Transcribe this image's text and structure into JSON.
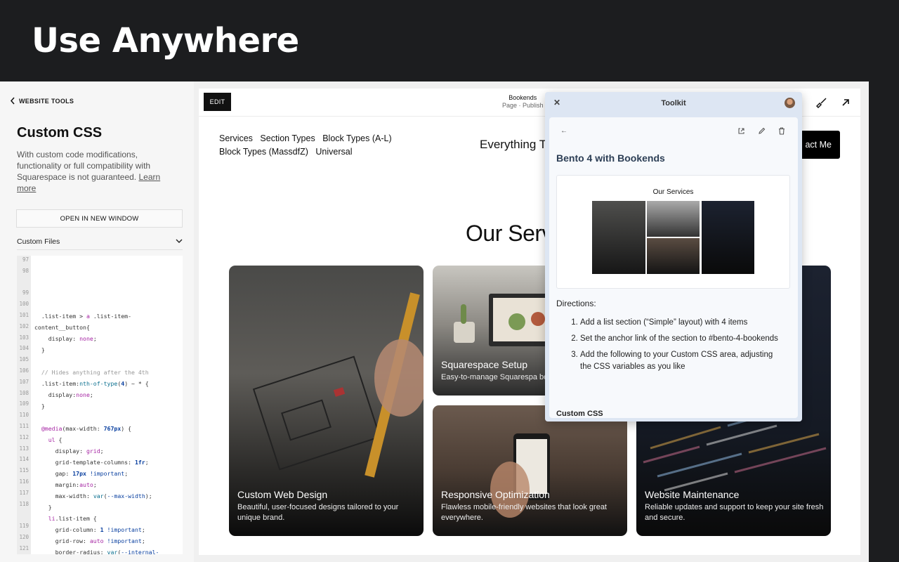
{
  "hero": {
    "title": "Use Anywhere"
  },
  "panel": {
    "back_label": "WEBSITE TOOLS",
    "title": "Custom CSS",
    "description": "With custom code modifications, functionality or full compatibility with Squarespace is not guaranteed.",
    "learn_more": "Learn more",
    "open_button": "OPEN IN NEW WINDOW",
    "files_label": "Custom Files"
  },
  "code": {
    "line_numbers": [
      "97",
      "98",
      "",
      "99",
      "100",
      "101",
      "102",
      "103",
      "104",
      "105",
      "106",
      "107",
      "108",
      "109",
      "110",
      "111",
      "112",
      "113",
      "114",
      "115",
      "116",
      "117",
      "118",
      "",
      "119",
      "120",
      "121"
    ]
  },
  "topbar": {
    "edit": "EDIT",
    "page_name": "Bookends",
    "page_sub": "Page · Publish"
  },
  "site": {
    "nav": [
      "Services",
      "Section Types",
      "Block Types (A-L)",
      "Block Types (MassdfZ)",
      "Universal"
    ],
    "title": "Everything T",
    "contact": "act Me",
    "section_title": "Our Serv"
  },
  "cards": [
    {
      "title": "Custom Web Design",
      "desc": "Beautiful, user-focused designs tailored to your unique brand."
    },
    {
      "title": "Squarespace Setup",
      "desc": "Easy-to-manage Squarespa boost your business."
    },
    {
      "title": "Responsive Optimization",
      "desc": "Flawless mobile-friendly websites that look great everywhere."
    },
    {
      "title": "Website Maintenance",
      "desc": "Reliable updates and support to keep your site fresh and secure."
    }
  ],
  "toolkit": {
    "title": "Toolkit",
    "item_title": "Bento 4 with Bookends",
    "thumb_title": "Our Services",
    "directions_label": "Directions:",
    "steps": [
      "Add a list section (“Simple” layout) with 4 items",
      "Set the anchor link of the section to #bento-4-bookends",
      "Add the following to your Custom CSS area, adjusting the CSS variables as you like"
    ],
    "css_heading": "Custom CSS"
  },
  "colors": {
    "hero_bg": "#1c1d1f",
    "toolkit_header": "#dde6f3",
    "toolkit_title": "#2c3e55"
  }
}
